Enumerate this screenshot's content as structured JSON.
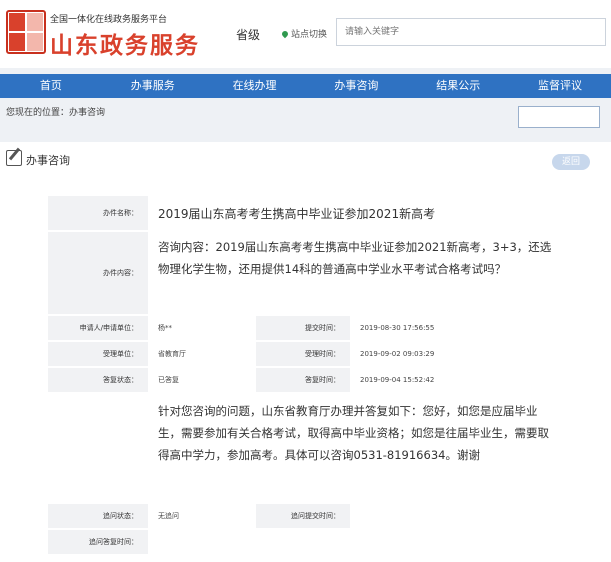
{
  "header": {
    "site_subtitle": "全国一体化在线政务服务平台",
    "site_name": "山东政务服务",
    "level": "省级",
    "location": "站点切换",
    "search_placeholder": "请输入关键字"
  },
  "nav": [
    "首页",
    "办事服务",
    "在线办理",
    "办事咨询",
    "结果公示",
    "监督评议"
  ],
  "breadcrumb": "您现在的位置：办事咨询",
  "panel": {
    "title": "办事咨询",
    "button": "返回"
  },
  "form": {
    "item_name_label": "办件名称：",
    "item_name": "2019届山东高考考生携高中毕业证参加2021新高考",
    "content_label": "办件内容：",
    "content": "咨询内容：2019届山东高考考生携高中毕业证参加2021新高考，3+3，还选物理化学生物，还用提供14科的普通高中学业水平考试合格考试吗？",
    "applicant_label": "申请人/申请单位：",
    "applicant": "杨**",
    "submit_time_label": "提交时间：",
    "submit_time": "2019-08-30 17:56:55",
    "dept_label": "受理单位：",
    "dept": "省教育厅",
    "accept_time_label": "受理时间：",
    "accept_time": "2019-09-02 09:03:29",
    "reply_status_label": "答复状态：",
    "reply_status": "已答复",
    "reply_time_label": "答复时间：",
    "reply_time": "2019-09-04 15:52:42",
    "reply": "针对您咨询的问题，山东省教育厅办理并答复如下：您好，如您是应届毕业生，需要参加有关合格考试，取得高中毕业资格；如您是往届毕业生，需要取得高中学力，参加高考。具体可以咨询0531-81916634。谢谢",
    "followup_status_label": "追问状态：",
    "followup_status": "无追问",
    "followup_submit_label": "追问提交时间：",
    "followup_submit": "",
    "followup_reply_label": "追问答复时间：",
    "followup_reply": ""
  }
}
